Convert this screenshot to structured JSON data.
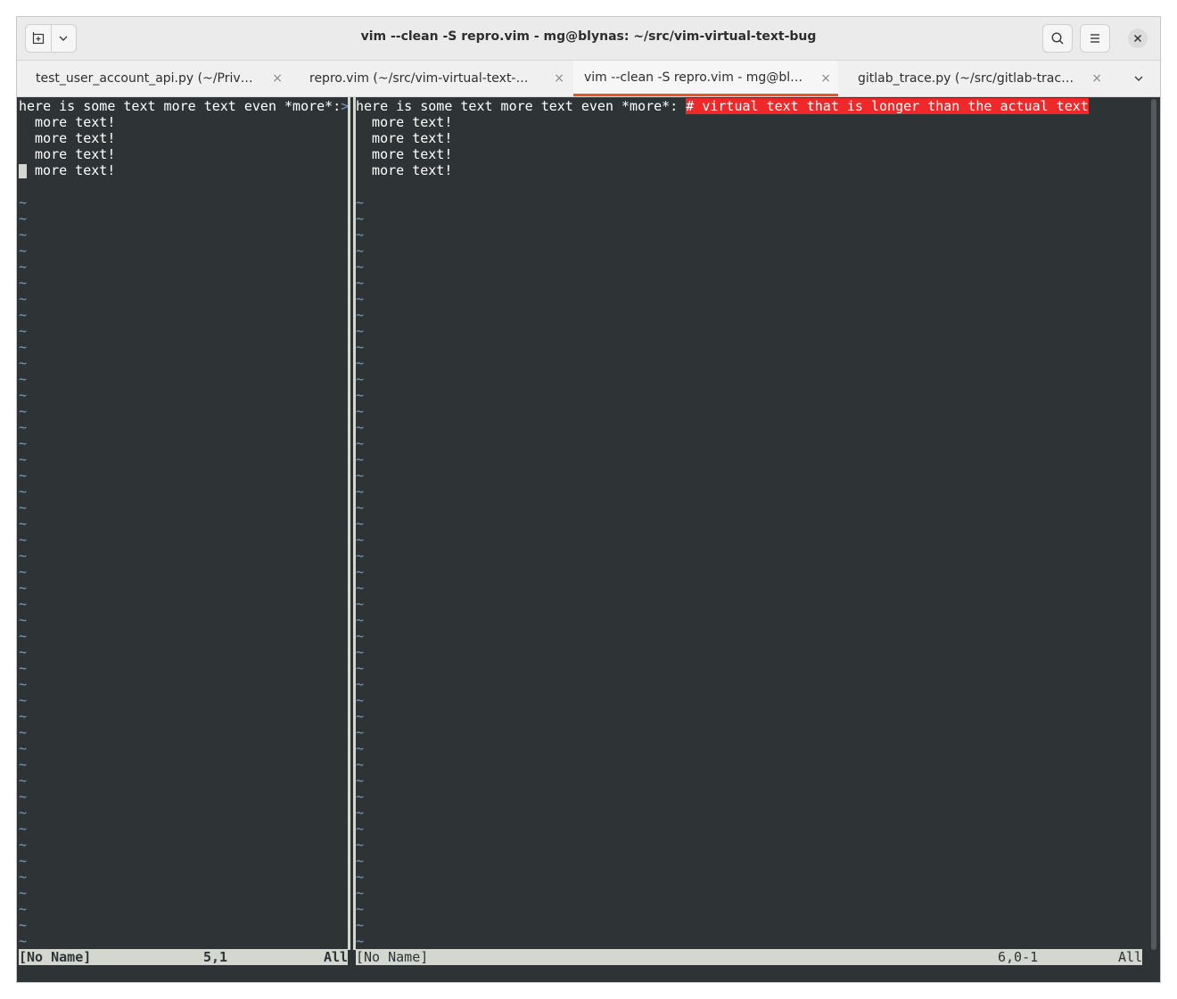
{
  "window": {
    "title": "vim --clean -S repro.vim - mg@blynas: ~/src/vim-virtual-text-bug"
  },
  "tabs": [
    {
      "label": "test_user_account_api.py (~/Privat…",
      "active": false
    },
    {
      "label": "repro.vim (~/src/vim-virtual-text-b…",
      "active": false
    },
    {
      "label": "vim --clean -S repro.vim - mg@blyn…",
      "active": true
    },
    {
      "label": "gitlab_trace.py (~/src/gitlab-trace)…",
      "active": false
    }
  ],
  "colors": {
    "terminal_bg": "#2e3436",
    "tilde": "#729fcf",
    "virtual_text_bg": "#ef2929",
    "active_tab_underline": "#e95420",
    "statusline_bg": "#d3d7cf"
  },
  "icons": {
    "new_tab": "new-tab-icon",
    "dropdown": "chevron-down-icon",
    "search": "search-icon",
    "menu": "hamburger-menu-icon",
    "close": "close-icon",
    "tab_close": "×"
  },
  "left_pane": {
    "first_line": "here is some text more text even *more*:",
    "overflow_marker": ">",
    "lines": [
      "more text!",
      "more text!",
      "more text!",
      "more text!"
    ],
    "line_indent": "  ",
    "tilde_char": "~",
    "status": {
      "name": "[No Name]",
      "position": "5,1",
      "scroll": "All"
    }
  },
  "right_pane": {
    "first_line": "here is some text more text even *more*: ",
    "virtual_text": "# virtual text that is longer than the actual text",
    "lines": [
      "more text!",
      "more text!",
      "more text!",
      "more text!"
    ],
    "line_indent": "  ",
    "tilde_char": "~",
    "status": {
      "name": "[No Name]",
      "position": "6,0-1",
      "scroll": "All"
    }
  }
}
